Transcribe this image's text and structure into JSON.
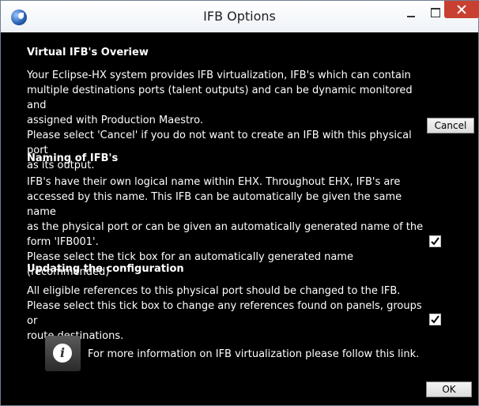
{
  "window": {
    "title": "IFB Options"
  },
  "sections": {
    "overview": {
      "heading": "Virtual IFB's Overiew",
      "lines": [
        "Your Eclipse-HX system provides IFB virtualization, IFB's which can contain",
        "multiple destinations ports (talent outputs) and can be dynamic monitored and",
        "assigned with Production Maestro.",
        "Please select 'Cancel' if you do not want to create an IFB with this physical port",
        "as its output."
      ],
      "cancel_label": "Cancel"
    },
    "naming": {
      "heading": "Naming of IFB's",
      "lines": [
        "IFB's have their own logical name within EHX. Throughout EHX, IFB's are",
        "accessed by this name. This IFB can be automatically be given the same name",
        "as the physical port or can be given an automatically generated name of the",
        "form 'IFB001'.",
        "Please select the tick box for an automatically generated name (recommended)"
      ],
      "checked": true
    },
    "updating": {
      "heading": "Updating the configuration",
      "lines": [
        "All eligible references to this physical port should be changed to the IFB.",
        "Please select this tick box to change any references found on panels, groups or",
        "route destinations."
      ],
      "checked": true
    }
  },
  "info": {
    "icon": "info-icon",
    "text": "For more information on IFB virtualization please follow this link."
  },
  "footer": {
    "ok_label": "OK"
  },
  "colors": {
    "background": "#000000",
    "text": "#ffffff",
    "close_button": "#c84031"
  }
}
